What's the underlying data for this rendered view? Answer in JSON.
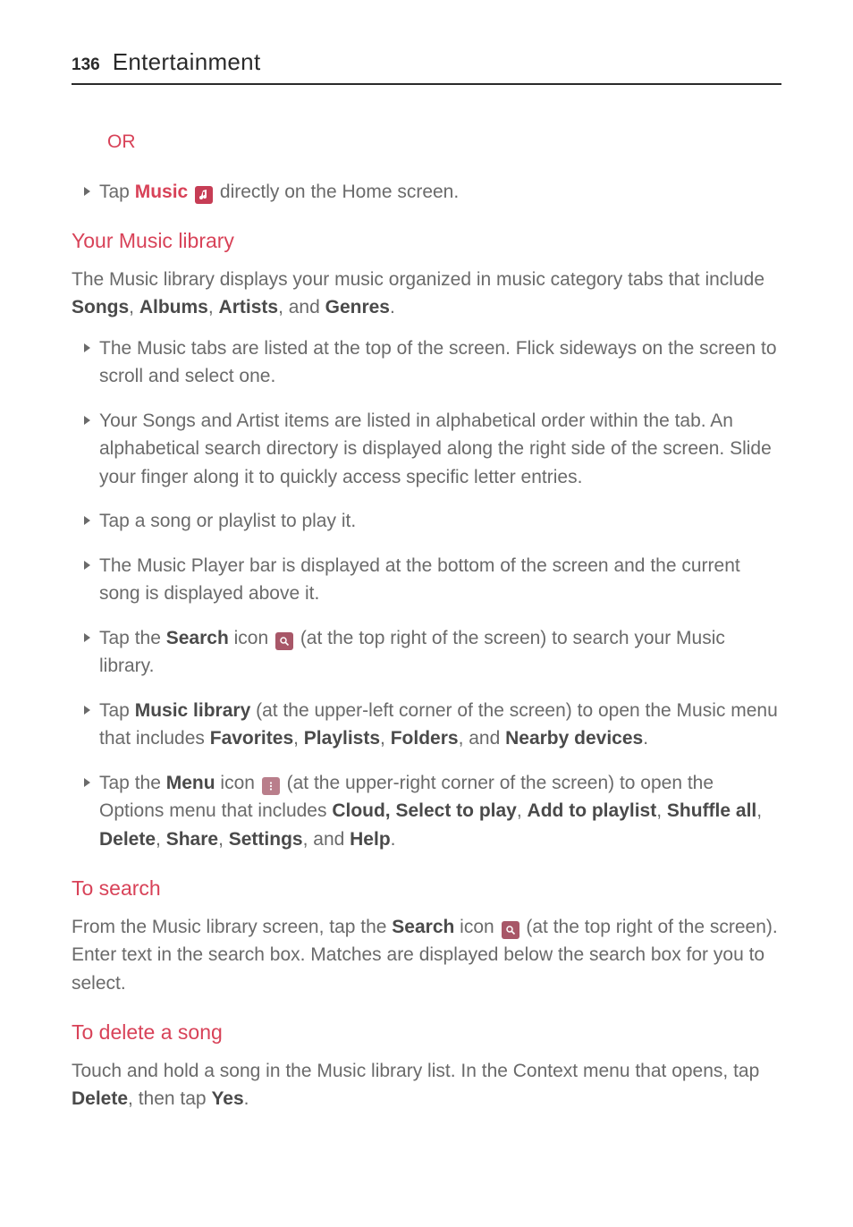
{
  "header": {
    "page": "136",
    "title": "Entertainment"
  },
  "or_label": "OR",
  "first_bullet": {
    "pre": "Tap ",
    "music_label": "Music",
    "post": " directly on the Home screen."
  },
  "library": {
    "heading": "Your Music library",
    "intro_pre": "The Music library displays your music organized in music category tabs that include ",
    "songs": "Songs",
    "c1": ", ",
    "albums": "Albums",
    "c2": ", ",
    "artists": "Artists",
    "c3": ", and ",
    "genres": "Genres",
    "period": ".",
    "items": {
      "b1": "The Music tabs are listed at the top of the screen. Flick sideways on the screen to scroll and select one.",
      "b2": "Your Songs and Artist items are listed in alphabetical order within the tab. An alphabetical search directory is displayed along the right side of the screen. Slide your finger along it to quickly access specific letter entries.",
      "b3": "Tap a song or playlist to play it.",
      "b4": "The Music Player bar is displayed at the bottom of the screen and the current song is displayed above it.",
      "b5_pre": "Tap the ",
      "b5_search": "Search",
      "b5_mid": " icon ",
      "b5_post": " (at the top right of the screen) to search your Music library.",
      "b6_pre": "Tap ",
      "b6_ml": "Music library",
      "b6_mid": " (at the upper-left corner of the screen) to open the Music menu that includes ",
      "b6_fav": "Favorites",
      "b6_c1": ", ",
      "b6_pl": "Playlists",
      "b6_c2": ", ",
      "b6_fo": "Folders",
      "b6_c3": ", and ",
      "b6_nb": "Nearby devices",
      "b6_period": ".",
      "b7_pre": "Tap the ",
      "b7_menu": "Menu",
      "b7_mid": " icon ",
      "b7_post1": " (at the upper-right corner of the screen) to open the Options menu that includes ",
      "b7_cloud": "Cloud, Select to play",
      "b7_c1": ", ",
      "b7_add": "Add to playlist",
      "b7_c2": ", ",
      "b7_shuf": "Shuffle all",
      "b7_c3": ", ",
      "b7_del": "Delete",
      "b7_c4": ", ",
      "b7_share": "Share",
      "b7_c5": ", ",
      "b7_set": "Settings",
      "b7_c6": ", and ",
      "b7_help": "Help",
      "b7_period": "."
    }
  },
  "to_search": {
    "heading": "To search",
    "pre": "From the Music library screen, tap the ",
    "search": "Search",
    "mid": " icon ",
    "post": " (at the top right of the screen). Enter text in the search box. Matches are displayed below the search box for you to select."
  },
  "to_delete": {
    "heading": "To delete a song",
    "pre": "Touch and hold a song in the Music library list. In the Context menu that opens, tap ",
    "delete": "Delete",
    "mid": ", then tap ",
    "yes": "Yes",
    "post": "."
  }
}
